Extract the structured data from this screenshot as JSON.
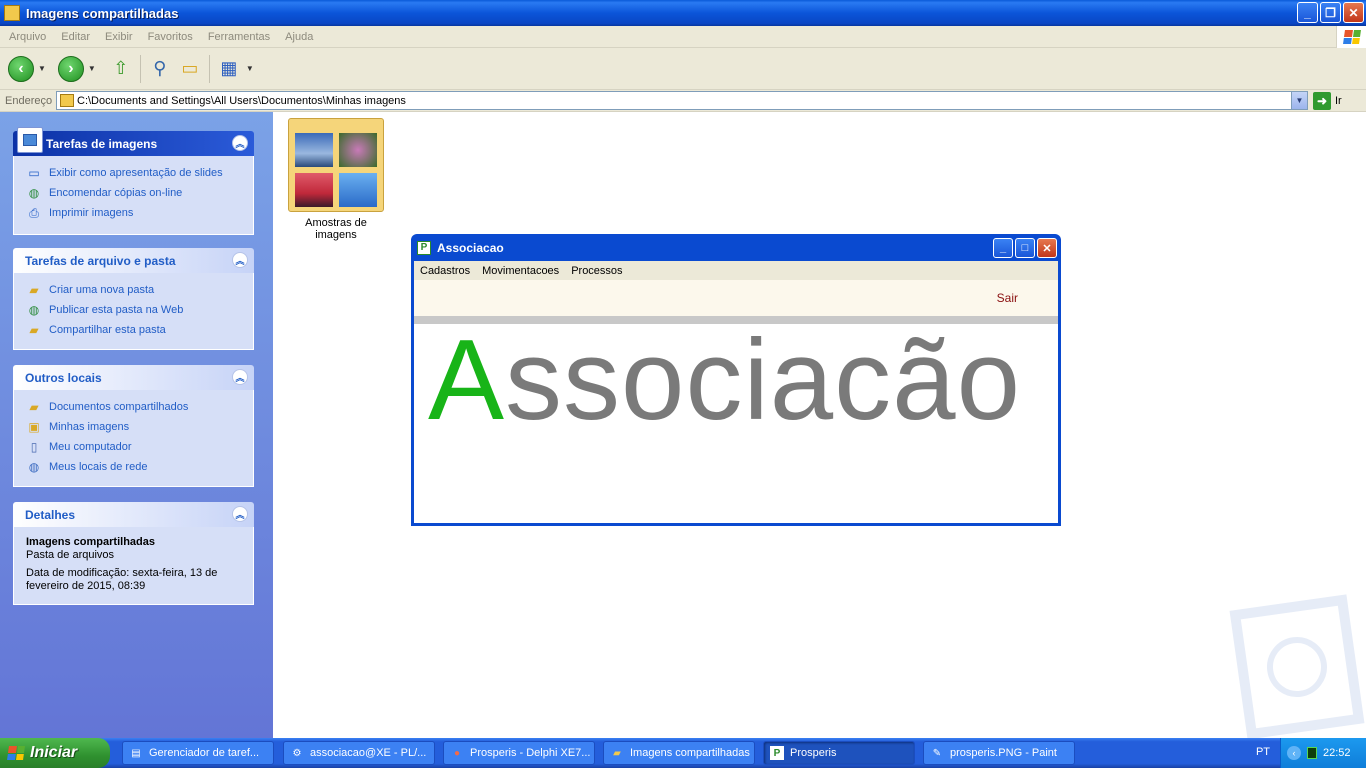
{
  "explorer": {
    "title": "Imagens compartilhadas",
    "menu": [
      "Arquivo",
      "Editar",
      "Exibir",
      "Favoritos",
      "Ferramentas",
      "Ajuda"
    ],
    "address_label": "Endereço",
    "address_value": "C:\\Documents and Settings\\All Users\\Documentos\\Minhas imagens",
    "go_label": "Ir"
  },
  "left_pane": {
    "image_tasks": {
      "title": "Tarefas de imagens",
      "items": [
        "Exibir como apresentação de slides",
        "Encomendar cópias on-line",
        "Imprimir imagens"
      ]
    },
    "file_tasks": {
      "title": "Tarefas de arquivo e pasta",
      "items": [
        "Criar uma nova pasta",
        "Publicar esta pasta na Web",
        "Compartilhar esta pasta"
      ]
    },
    "other_places": {
      "title": "Outros locais",
      "items": [
        "Documentos compartilhados",
        "Minhas imagens",
        "Meu computador",
        "Meus locais de rede"
      ]
    },
    "details": {
      "title": "Detalhes",
      "name": "Imagens compartilhadas",
      "type": "Pasta de arquivos",
      "modified": "Data de modificação: sexta-feira, 13 de fevereiro de 2015, 08:39"
    }
  },
  "content": {
    "folder_label": "Amostras de imagens"
  },
  "app_window": {
    "title": "Associacao",
    "menu": [
      "Cadastros",
      "Movimentacoes",
      "Processos"
    ],
    "sair_label": "Sair",
    "logo_first": "A",
    "logo_rest": "ssociacão"
  },
  "taskbar": {
    "start_label": "Iniciar",
    "tasks": [
      "Gerenciador de taref...",
      "associacao@XE - PL/...",
      "Prosperis - Delphi XE7...",
      "Imagens compartilhadas",
      "Prosperis",
      "prosperis.PNG - Paint"
    ],
    "language": "PT",
    "clock": "22:52"
  },
  "colors": {
    "xp_blue": "#0a46c4",
    "logo_green": "#18b418",
    "logo_gray": "#7a7a7a",
    "sair_red": "#8a1010"
  }
}
